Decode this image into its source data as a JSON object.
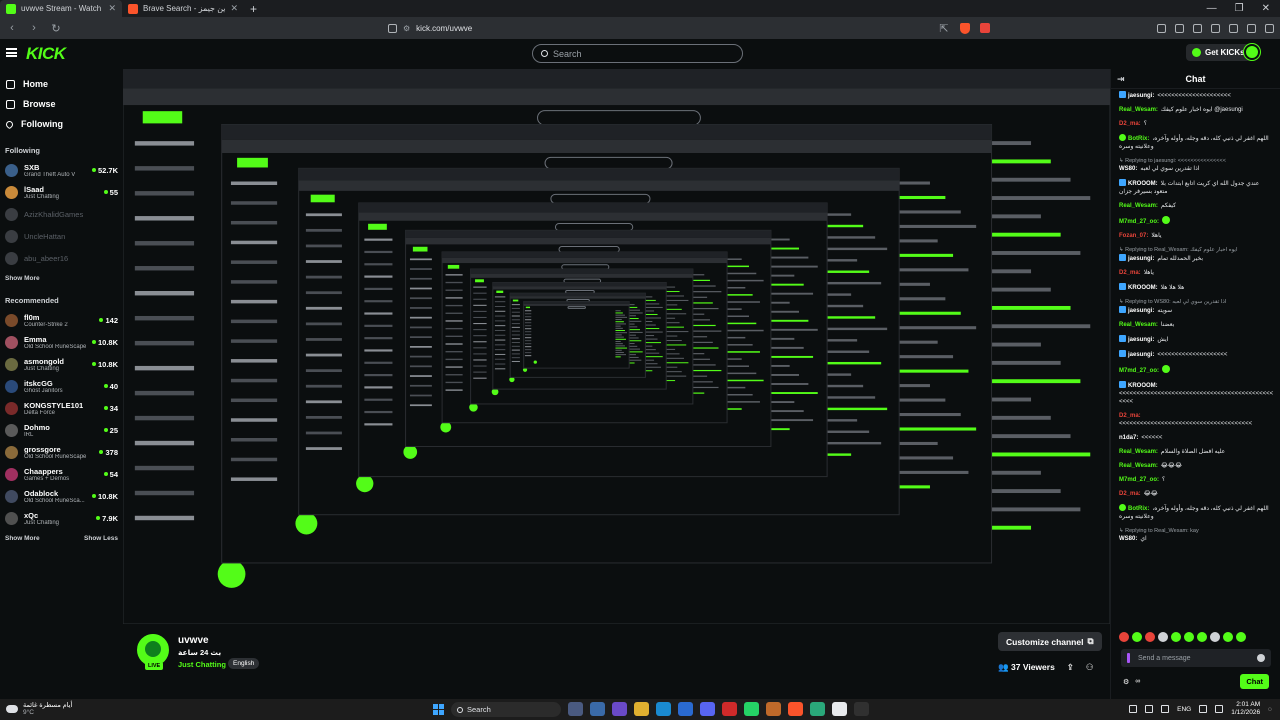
{
  "browser": {
    "tabs": [
      {
        "title": "uvwve Stream - Watch Live on Kick",
        "active": true,
        "favicon_color": "#53fc18"
      },
      {
        "title": "Brave Search - بكاين جيمز",
        "active": false,
        "favicon_color": "#fb542b"
      }
    ],
    "url": "kick.com/uvwve",
    "new_tab_symbol": "+",
    "window_controls": [
      "—",
      "❐",
      "✕"
    ]
  },
  "header": {
    "logo": "KICK",
    "search_placeholder": "Search",
    "get_kicks_label": "Get KICKs",
    "accent": "#53fc18"
  },
  "sidebar": {
    "nav": [
      {
        "label": "Home",
        "icon": "home-icon"
      },
      {
        "label": "Browse",
        "icon": "browse-icon"
      },
      {
        "label": "Following",
        "icon": "heart-icon"
      }
    ],
    "following_heading": "Following",
    "following": [
      {
        "name": "SXB",
        "category": "Grand Theft Auto V",
        "viewers": "52.7K",
        "online": true,
        "color": "#3a5f8a"
      },
      {
        "name": "lSaad",
        "category": "Just Chatting",
        "viewers": "55",
        "online": true,
        "color": "#c98a3a"
      },
      {
        "name": "AzizKhalidGames",
        "category": "",
        "viewers": "",
        "online": false,
        "color": "#3a3d42"
      },
      {
        "name": "UncleHattan",
        "category": "",
        "viewers": "",
        "online": false,
        "color": "#3a3d42"
      },
      {
        "name": "abu_abeer16",
        "category": "",
        "viewers": "",
        "online": false,
        "color": "#3a3d42"
      }
    ],
    "show_more": "Show More",
    "recommended_heading": "Recommended",
    "recommended": [
      {
        "name": "fl0m",
        "category": "Counter-Strike 2",
        "viewers": "142",
        "color": "#7a4a2a"
      },
      {
        "name": "Emma",
        "category": "Old School RuneScape",
        "viewers": "10.8K",
        "color": "#a05060"
      },
      {
        "name": "asmongold",
        "category": "Just Chatting",
        "viewers": "10.8K",
        "color": "#6a6a40"
      },
      {
        "name": "itskcGG",
        "category": "Ghost Janitors",
        "viewers": "40",
        "color": "#2a4a7a"
      },
      {
        "name": "KONGSTYLE101",
        "category": "Delta Force",
        "viewers": "34",
        "color": "#7a2a2a"
      },
      {
        "name": "Dohmo",
        "category": "IRL",
        "viewers": "25",
        "color": "#5a5a5a"
      },
      {
        "name": "grossgore",
        "category": "Old School RuneScape",
        "viewers": "378",
        "color": "#8a6a3a"
      },
      {
        "name": "Chaappers",
        "category": "Games + Demos",
        "viewers": "54",
        "color": "#a03060"
      },
      {
        "name": "Odablock",
        "category": "Old School RuneSca...",
        "viewers": "10.8K",
        "color": "#404a60"
      },
      {
        "name": "xQc",
        "category": "Just Chatting",
        "viewers": "7.9K",
        "color": "#505050"
      }
    ],
    "show_more_bottom": "Show More",
    "show_less": "Show Less"
  },
  "channel": {
    "name": "uvwve",
    "title": "بث 24 ساعة",
    "category": "Just Chatting",
    "tag": "English",
    "live_badge": "LIVE",
    "customize_label": "Customize channel",
    "viewers": "37",
    "viewers_label": "Viewers"
  },
  "chat": {
    "title": "Chat",
    "messages": [
      {
        "user": "jaesungi:",
        "color": "#ffffff",
        "badge": "blue",
        "text": "<<<<<<<<<<<<<<<<<<<<<",
        "reply": ""
      },
      {
        "user": "Real_Wesam:",
        "color": "#53fc18",
        "badge": "",
        "text": "ايوه اخبار علوم كيفك @jaesungi",
        "reply": ""
      },
      {
        "user": "D2_ma:",
        "color": "#e8443a",
        "badge": "",
        "text": "؟",
        "reply": ""
      },
      {
        "user": "BotRix:",
        "color": "#53fc18",
        "badge": "green",
        "text": "اللهم اغفر لي ذنبي كله، دقه وجله، وأوله وآخره، وعلانيته وسره",
        "reply": ""
      },
      {
        "user": "WS80:",
        "color": "#ffffff",
        "badge": "",
        "text": "اذا تقدرين سوي لي لعبه",
        "reply": "Replying to jaesungi: <<<<<<<<<<<<<<<"
      },
      {
        "user": "KROOOM:",
        "color": "#ffffff",
        "badge": "blue",
        "text": "عندي جدول الله اي كريت اتابع ابتدات بلا متعود بسيرفر جزان",
        "reply": ""
      },
      {
        "user": "Real_Wesam:",
        "color": "#53fc18",
        "badge": "",
        "text": "كيفكم",
        "reply": ""
      },
      {
        "user": "M7md_27_oo:",
        "color": "#53fc18",
        "badge": "",
        "text": "",
        "reply": ""
      },
      {
        "user": "Fozan_07:",
        "color": "#e8443a",
        "badge": "",
        "text": "ياهلا",
        "reply": ""
      },
      {
        "user": "jaesungi:",
        "color": "#ffffff",
        "badge": "blue",
        "text": "بخير الحمدلله تمام",
        "reply": "Replying to Real_Wesam: ايوه اخبار علوم كيفك"
      },
      {
        "user": "D2_ma:",
        "color": "#e8443a",
        "badge": "",
        "text": "ياهلا",
        "reply": ""
      },
      {
        "user": "KROOOM:",
        "color": "#ffffff",
        "badge": "blue",
        "text": "هلا هلا هلا",
        "reply": ""
      },
      {
        "user": "jaesungi:",
        "color": "#ffffff",
        "badge": "blue",
        "text": "سويته",
        "reply": "Replying to WS80: اذا تقدرين سوي لي لعبه"
      },
      {
        "user": "Real_Wesam:",
        "color": "#53fc18",
        "badge": "",
        "text": "بعضنا",
        "reply": ""
      },
      {
        "user": "jaesungi:",
        "color": "#ffffff",
        "badge": "blue",
        "text": "ايش",
        "reply": ""
      },
      {
        "user": "jaesungi:",
        "color": "#ffffff",
        "badge": "blue",
        "text": "<<<<<<<<<<<<<<<<<<<<",
        "reply": ""
      },
      {
        "user": "M7md_27_oo:",
        "color": "#53fc18",
        "badge": "",
        "text": "",
        "reply": ""
      },
      {
        "user": "KROOOM:",
        "color": "#ffffff",
        "badge": "blue",
        "text": "<<<<<<<<<<<<<<<<<<<<<<<<<<<<<<<<<<<<<<<<<<<<<<<<",
        "reply": ""
      },
      {
        "user": "D2_ma:",
        "color": "#e8443a",
        "badge": "",
        "text": "<<<<<<<<<<<<<<<<<<<<<<<<<<<<<<<<<<<<<<",
        "reply": ""
      },
      {
        "user": "n1da7:",
        "color": "#ffffff",
        "badge": "",
        "text": "<<<<<<",
        "reply": ""
      },
      {
        "user": "Real_Wesam:",
        "color": "#53fc18",
        "badge": "",
        "text": "عليه افضل الصلاة والسلام",
        "reply": ""
      },
      {
        "user": "Real_Wesam:",
        "color": "#53fc18",
        "badge": "",
        "text": "😂😂😂",
        "reply": ""
      },
      {
        "user": "M7md_27_oo:",
        "color": "#53fc18",
        "badge": "",
        "text": "؟",
        "reply": ""
      },
      {
        "user": "D2_ma:",
        "color": "#e8443a",
        "badge": "",
        "text": "😂😂",
        "reply": ""
      },
      {
        "user": "BotRix:",
        "color": "#53fc18",
        "badge": "green",
        "text": "اللهم اغفر لي ذنبي كله، دقه وجله، وأوله وآخره، وعلانيته وسره",
        "reply": ""
      },
      {
        "user": "WS80:",
        "color": "#ffffff",
        "badge": "",
        "text": "اي",
        "reply": "Replying to Real_Wesam: kay"
      }
    ],
    "send_placeholder": "Send a message",
    "chat_button": "Chat"
  },
  "taskbar": {
    "weather_line1": "أيام مسطرة غائمة",
    "weather_line2": "9°C",
    "search_label": "Search",
    "lang": "ENG",
    "time": "2:01 AM",
    "date": "1/12/2026"
  }
}
